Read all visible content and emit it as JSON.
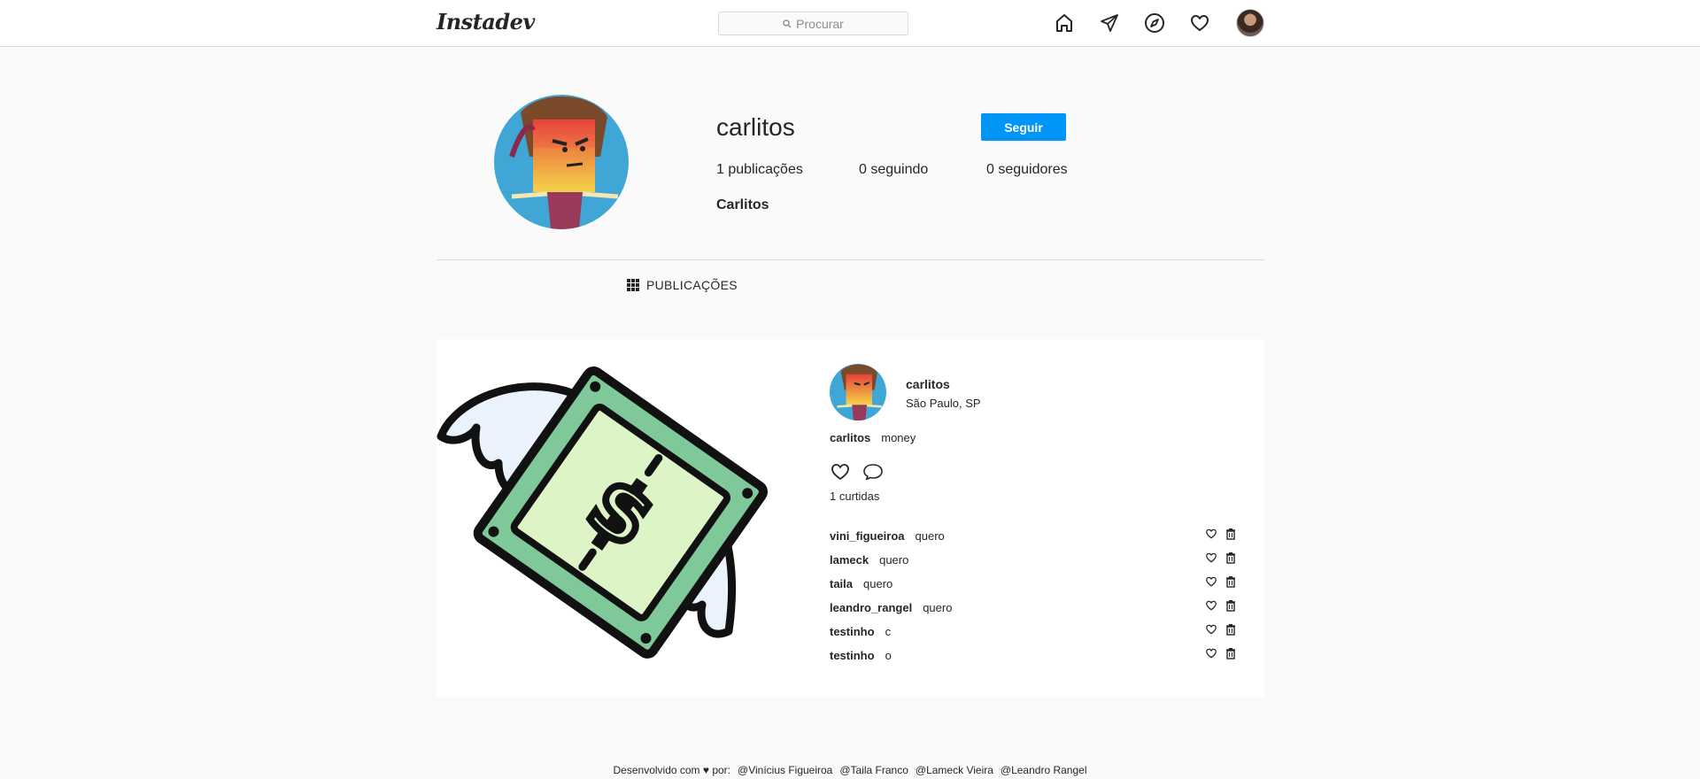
{
  "header": {
    "logo": "Instadev",
    "search_placeholder": "Procurar",
    "icons": [
      "home-icon",
      "direct-icon",
      "explore-icon",
      "heart-icon",
      "avatar"
    ]
  },
  "profile": {
    "username": "carlitos",
    "follow_label": "Seguir",
    "posts": "1 publicações",
    "following": "0 seguindo",
    "followers": "0 seguidores",
    "full_name": "Carlitos"
  },
  "tabs": {
    "posts_label": "PUBLICAÇÕES"
  },
  "post": {
    "username": "carlitos",
    "location": "São Paulo, SP",
    "caption_user": "carlitos",
    "caption_text": "money",
    "likes": "1 curtidas",
    "comments": [
      {
        "user": "vini_figueiroa",
        "text": "quero"
      },
      {
        "user": "lameck",
        "text": "quero"
      },
      {
        "user": "taila",
        "text": "quero"
      },
      {
        "user": "leandro_rangel",
        "text": "quero"
      },
      {
        "user": "testinho",
        "text": "c"
      },
      {
        "user": "testinho",
        "text": "o"
      }
    ]
  },
  "footer": {
    "prefix": "Desenvolvido com ♥ por:",
    "authors": [
      "@Vinícius Figueiroa",
      "@Taila Franco",
      "@Lameck Vieira",
      "@Leandro Rangel"
    ]
  },
  "colors": {
    "accent": "#0095f6",
    "background": "#fafafa",
    "border": "#dbdbdb"
  }
}
